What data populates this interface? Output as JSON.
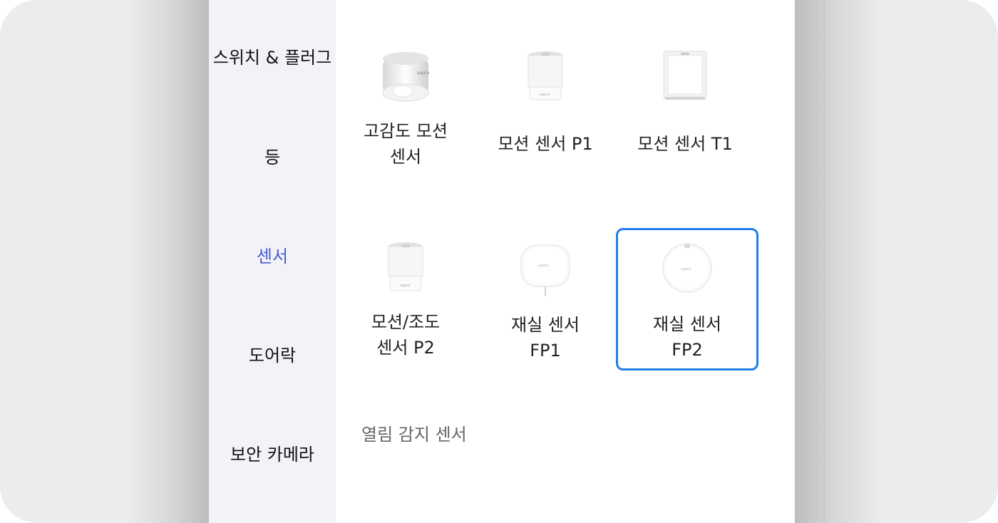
{
  "sidebar": {
    "items": [
      {
        "label": "스위치 & 플러그",
        "active": false
      },
      {
        "label": "등",
        "active": false
      },
      {
        "label": "센서",
        "active": true
      },
      {
        "label": "도어락",
        "active": false
      },
      {
        "label": "보안 카메라",
        "active": false
      }
    ]
  },
  "products": [
    {
      "line1": "고감도 모션",
      "line2": "센서",
      "icon": "high-precision-motion-sensor"
    },
    {
      "line1": "모션 센서 P1",
      "line2": "",
      "icon": "motion-sensor-p1"
    },
    {
      "line1": "모션 센서 T1",
      "line2": "",
      "icon": "motion-sensor-t1"
    },
    {
      "line1": "모션/조도",
      "line2": "센서 P2",
      "icon": "motion-light-sensor-p2"
    },
    {
      "line1": "재실 센서",
      "line2": "FP1",
      "icon": "presence-sensor-fp1"
    },
    {
      "line1": "재실 센서",
      "line2": "FP2",
      "icon": "presence-sensor-fp2",
      "selected": true
    }
  ],
  "section": {
    "title": "열림 감지 센서"
  },
  "colors": {
    "accent": "#4a5bd6",
    "selection_border": "#1f7fe6",
    "sidebar_bg": "#f2f3f7"
  }
}
